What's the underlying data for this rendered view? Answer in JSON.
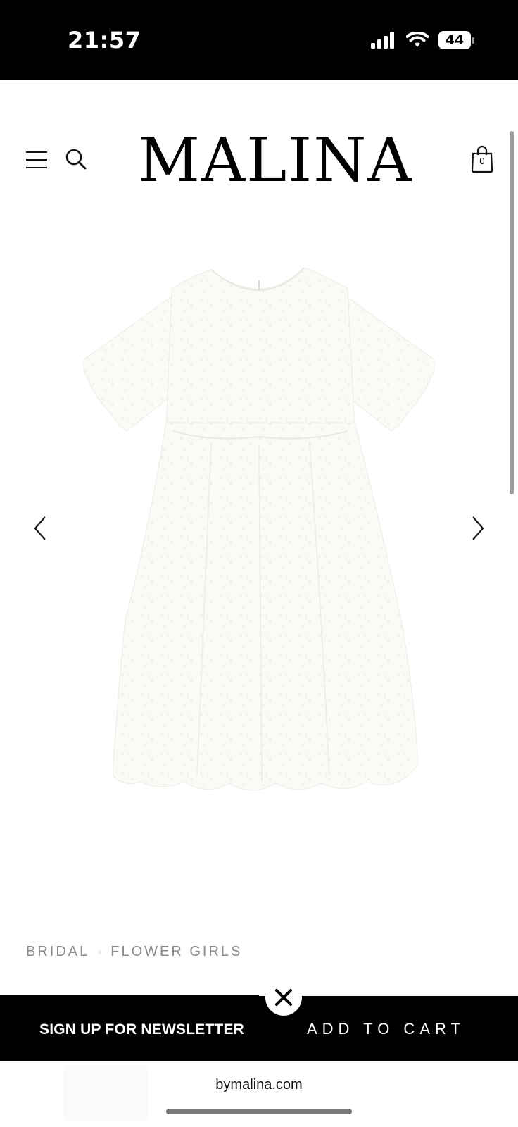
{
  "status_bar": {
    "time": "21:57",
    "battery": "44",
    "icons": [
      "signal-icon",
      "wifi-icon",
      "battery-icon"
    ]
  },
  "header": {
    "logo": "MALINA",
    "bag_count": "0",
    "icons": [
      "menu-icon",
      "search-icon",
      "shopping-bag-icon"
    ]
  },
  "breadcrumb": {
    "items": [
      "BRIDAL",
      "FLOWER GIRLS"
    ]
  },
  "bottom_bar": {
    "newsletter_label": "SIGN UP FOR NEWSLETTER",
    "add_to_cart_label": "ADD TO CART",
    "close_icon": "close-icon"
  },
  "browser": {
    "url": "bymalina.com"
  },
  "colors": {
    "black": "#000000",
    "white": "#ffffff",
    "breadcrumb": "#8a8a8a"
  }
}
